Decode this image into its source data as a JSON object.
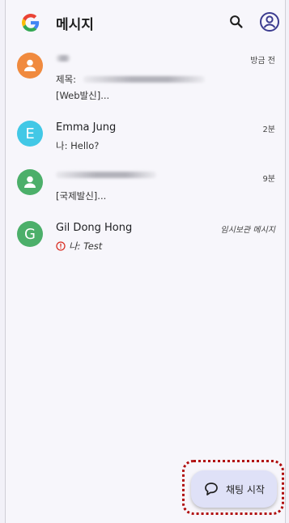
{
  "app": {
    "title": "메시지",
    "logo_icon": "google-g-icon",
    "search_icon": "search-icon",
    "account_icon": "account-circle-icon"
  },
  "conversations": [
    {
      "avatar_icon": "person-icon",
      "avatar_color": "#f08a3e",
      "name": "",
      "time": "방금 전",
      "line1": "제목:",
      "line2": "[Web발신]..."
    },
    {
      "avatar_letter": "E",
      "avatar_color": "#42c8e6",
      "name": "Emma Jung",
      "time": "2분",
      "line1": "나: Hello?"
    },
    {
      "avatar_icon": "person-icon",
      "avatar_color": "#4caf6a",
      "name": "",
      "time": "9분",
      "line1": "[국제발신]..."
    },
    {
      "avatar_letter": "G",
      "avatar_color": "#4caf6a",
      "name": "Gil Dong Hong",
      "time": "임시보관 메시지",
      "status_icon": "error-icon",
      "line1": "나: Test"
    }
  ],
  "fab": {
    "label": "채팅 시작",
    "icon": "chat-bubble-icon"
  }
}
